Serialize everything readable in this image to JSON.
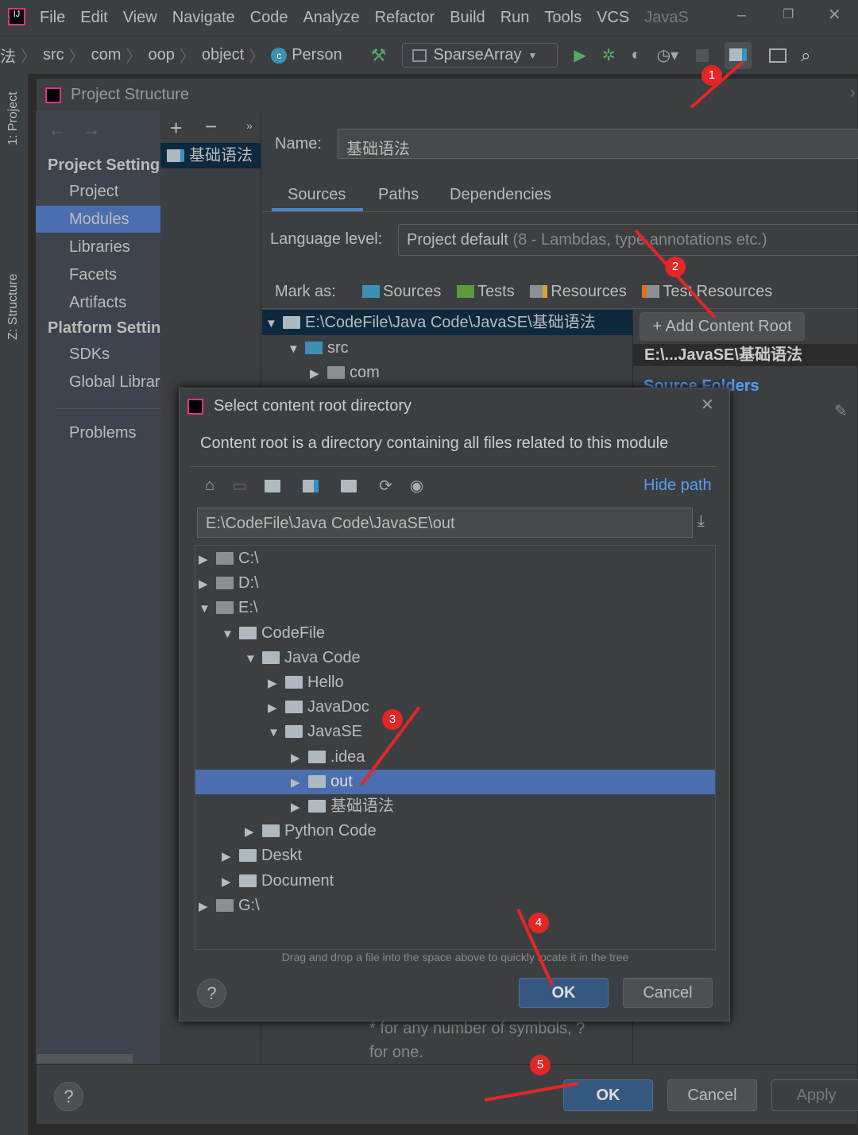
{
  "menu": [
    "File",
    "Edit",
    "View",
    "Navigate",
    "Code",
    "Analyze",
    "Refactor",
    "Build",
    "Run",
    "Tools",
    "VCS",
    "JavaS"
  ],
  "breadcrumb": [
    "法",
    "src",
    "com",
    "oop",
    "object",
    "Person"
  ],
  "run_config": "SparseArray",
  "tool_strip": {
    "project": "1: Project",
    "structure": "Z: Structure"
  },
  "dialog": {
    "title": "Project Structure",
    "nav": {
      "project_settings": "Project Settings",
      "items1": [
        "Project",
        "Modules",
        "Libraries",
        "Facets",
        "Artifacts"
      ],
      "platform_settings": "Platform Settings",
      "items2": [
        "SDKs",
        "Global Libraries"
      ],
      "problems": "Problems",
      "selected": "Modules"
    },
    "module": "基础语法",
    "name_label": "Name:",
    "name_value": "基础语法",
    "tabs": [
      "Sources",
      "Paths",
      "Dependencies"
    ],
    "active_tab": "Sources",
    "language_label": "Language level:",
    "language_value": "Project default",
    "language_hint": "(8 - Lambdas, type annotations etc.)",
    "mark_as": "Mark as:",
    "marks": [
      "Sources",
      "Tests",
      "Resources",
      "Test Resources"
    ],
    "content_tree": [
      "E:\\CodeFile\\Java Code\\JavaSE\\基础语法",
      "src",
      "com"
    ],
    "add_content_root": "+ Add Content Root",
    "root_header": "E:\\...JavaSE\\基础语法",
    "source_folders": "Source Folders",
    "hint1": "* for any number of symbols, ?",
    "hint2": "for one.",
    "ok": "OK",
    "cancel": "Cancel",
    "apply": "Apply"
  },
  "chooser": {
    "title": "Select content root directory",
    "description": "Content root is a directory containing all files related to this module",
    "hide_path": "Hide path",
    "path": "E:\\CodeFile\\Java Code\\JavaSE\\out",
    "tree": [
      {
        "label": "C:\\",
        "level": 0,
        "state": "collapsed",
        "drive": true
      },
      {
        "label": "D:\\",
        "level": 0,
        "state": "collapsed",
        "drive": true
      },
      {
        "label": "E:\\",
        "level": 0,
        "state": "expanded",
        "drive": true
      },
      {
        "label": "CodeFile",
        "level": 1,
        "state": "expanded"
      },
      {
        "label": "Java Code",
        "level": 2,
        "state": "expanded"
      },
      {
        "label": "Hello",
        "level": 3,
        "state": "collapsed"
      },
      {
        "label": "JavaDoc",
        "level": 3,
        "state": "collapsed"
      },
      {
        "label": "JavaSE",
        "level": 3,
        "state": "expanded"
      },
      {
        "label": ".idea",
        "level": 4,
        "state": "collapsed"
      },
      {
        "label": "out",
        "level": 4,
        "state": "collapsed",
        "selected": true
      },
      {
        "label": "基础语法",
        "level": 4,
        "state": "collapsed"
      },
      {
        "label": "Python Code",
        "level": 2,
        "state": "collapsed"
      },
      {
        "label": "Deskt",
        "level": 1,
        "state": "collapsed"
      },
      {
        "label": "Document",
        "level": 1,
        "state": "collapsed"
      },
      {
        "label": "G:\\",
        "level": 0,
        "state": "collapsed",
        "drive": true
      }
    ],
    "drag_hint": "Drag and drop a file into the space above to quickly locate it in the tree",
    "ok": "OK",
    "cancel": "Cancel",
    "help": "?"
  },
  "annotations": [
    "1",
    "2",
    "3",
    "4",
    "5"
  ],
  "colors": {
    "accent": "#4b6eaf",
    "annotation": "#e32626",
    "link": "#589df6",
    "sources": "#3d8fb4",
    "tests": "#5c9a3e"
  }
}
